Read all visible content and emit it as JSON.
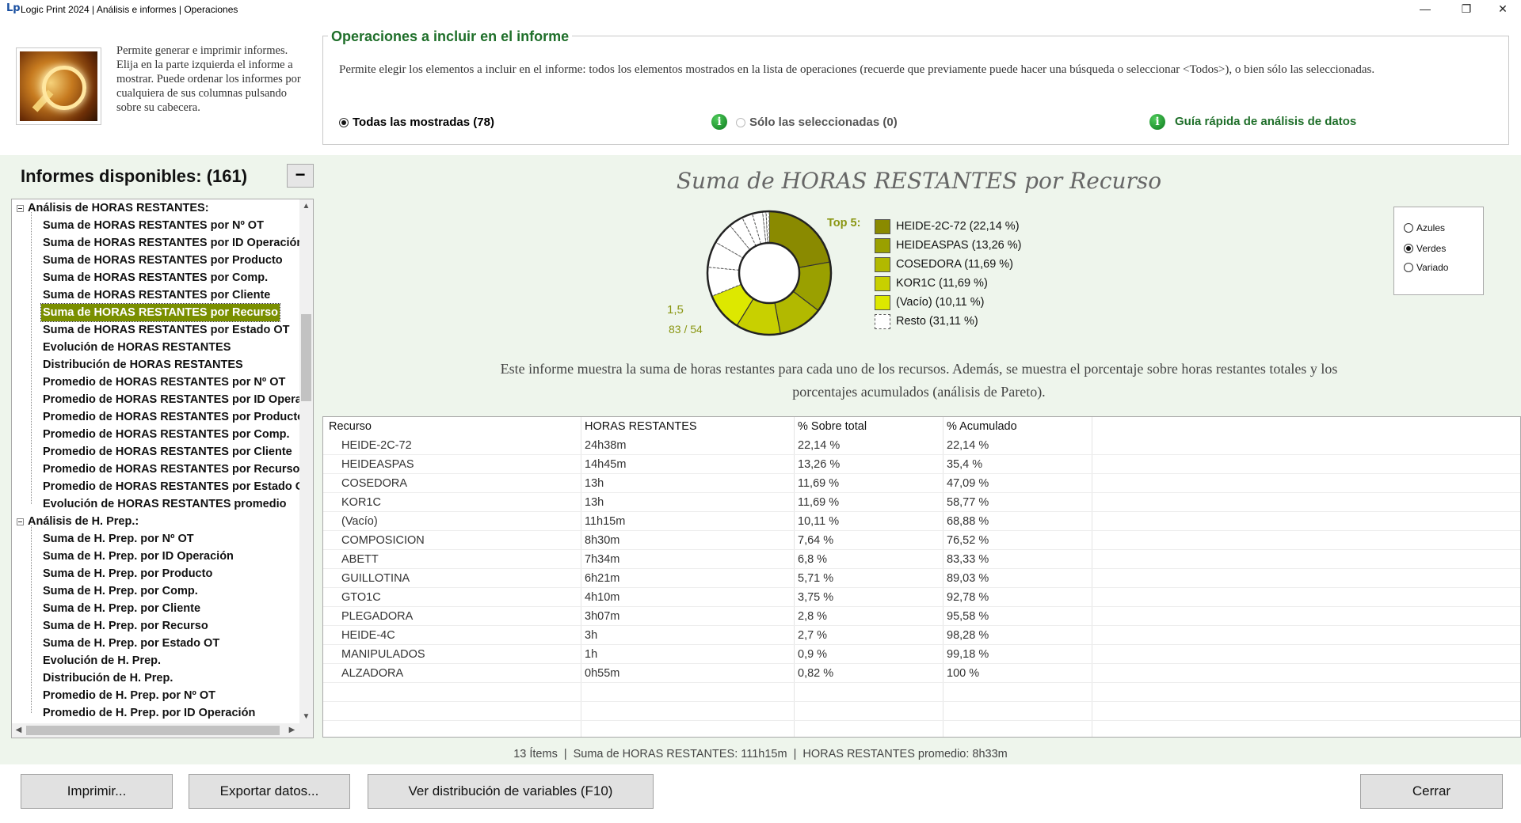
{
  "window": {
    "title": "Logic Print 2024 | Análisis e informes | Operaciones",
    "logo": "Lp",
    "minimize": "—",
    "restore": "❐",
    "close": "✕"
  },
  "intro": {
    "text": "Permite generar e imprimir informes. Elija en la parte izquierda el informe a mostrar. Puede ordenar los informes por cualquiera de sus columnas pulsando sobre su cabecera."
  },
  "operations": {
    "title": "Operaciones a incluir en el informe",
    "description": "Permite elegir los elementos a incluir en el informe: todos los elementos mostrados en la lista de operaciones (recuerde que previamente puede hacer una búsqueda o seleccionar <Todos>), o bien sólo las seleccionadas.",
    "option_all": "Todas las mostradas (78)",
    "option_selected": "Sólo las seleccionadas (0)",
    "guide_link": "Guía rápida de análisis de datos",
    "info_glyph": "i"
  },
  "reports": {
    "header": "Informes disponibles:  (161)",
    "collapse_label": "−",
    "groups": [
      {
        "label": "Análisis de HORAS RESTANTES:",
        "items": [
          "Suma de HORAS RESTANTES por Nº OT",
          "Suma de HORAS RESTANTES por ID Operación",
          "Suma de HORAS RESTANTES por Producto",
          "Suma de HORAS RESTANTES por Comp.",
          "Suma de HORAS RESTANTES por Cliente",
          "Suma de HORAS RESTANTES por Recurso",
          "Suma de HORAS RESTANTES por Estado OT",
          "Evolución de HORAS RESTANTES",
          "Distribución de HORAS RESTANTES",
          "Promedio de HORAS RESTANTES por Nº OT",
          "Promedio de HORAS RESTANTES por ID Opera",
          "Promedio de HORAS RESTANTES por Producto",
          "Promedio de HORAS RESTANTES por Comp.",
          "Promedio de HORAS RESTANTES por Cliente",
          "Promedio de HORAS RESTANTES por Recurso",
          "Promedio de HORAS RESTANTES por Estado O",
          "Evolución de HORAS RESTANTES promedio"
        ]
      },
      {
        "label": "Análisis de H. Prep.:",
        "items": [
          "Suma de H. Prep. por Nº OT",
          "Suma de H. Prep. por ID Operación",
          "Suma de H. Prep. por Producto",
          "Suma de H. Prep. por Comp.",
          "Suma de H. Prep. por Cliente",
          "Suma de H. Prep. por Recurso",
          "Suma de H. Prep. por Estado OT",
          "Evolución de H. Prep.",
          "Distribución de H. Prep.",
          "Promedio de H. Prep. por Nº OT",
          "Promedio de H. Prep. por ID Operación"
        ]
      }
    ],
    "selected": "Suma de HORAS RESTANTES por Recurso",
    "scroll_up": "▲",
    "scroll_down": "▼",
    "scroll_left": "◀",
    "scroll_right": "▶"
  },
  "chart": {
    "title": "Suma de HORAS RESTANTES por Recurso",
    "top5_label": "Top 5:",
    "scale_value": "1,5",
    "ratio_value": "83 / 54",
    "description": "Este informe muestra la suma de horas restantes para cada uno de los recursos. Además, se muestra el porcentaje sobre horas restantes totales y los porcentajes acumulados (análisis de Pareto).",
    "palette": {
      "options": [
        "Azules",
        "Verdes",
        "Variado"
      ],
      "selected": "Verdes"
    }
  },
  "chart_data": {
    "type": "pie",
    "title": "Suma de HORAS RESTANTES por Recurso",
    "slices": [
      {
        "label": "HEIDE-2C-72 (22,14 %)",
        "value": 22.14,
        "color": "#8a8a00"
      },
      {
        "label": "HEIDEASPAS (13,26 %)",
        "value": 13.26,
        "color": "#9aa000"
      },
      {
        "label": "COSEDORA (11,69 %)",
        "value": 11.69,
        "color": "#b2b900"
      },
      {
        "label": "KOR1C (11,69 %)",
        "value": 11.69,
        "color": "#c8d000"
      },
      {
        "label": "(Vacío) (10,11 %)",
        "value": 10.11,
        "color": "#dde800"
      },
      {
        "label": "Resto (31,11 %)",
        "value": 31.11,
        "color": "#ffffff",
        "rest": true
      }
    ],
    "rest_subdivisions": [
      7.64,
      6.8,
      5.71,
      3.75,
      2.8,
      2.7,
      0.9,
      0.82
    ]
  },
  "table": {
    "headers": [
      "Recurso",
      "HORAS RESTANTES",
      "% Sobre total",
      "% Acumulado"
    ],
    "rows": [
      [
        "HEIDE-2C-72",
        "24h38m",
        "22,14 %",
        "22,14 %"
      ],
      [
        "HEIDEASPAS",
        "14h45m",
        "13,26 %",
        "35,4 %"
      ],
      [
        "COSEDORA",
        "13h",
        "11,69 %",
        "47,09 %"
      ],
      [
        "KOR1C",
        "13h",
        "11,69 %",
        "58,77 %"
      ],
      [
        "(Vacío)",
        "11h15m",
        "10,11 %",
        "68,88 %"
      ],
      [
        "COMPOSICION",
        "8h30m",
        "7,64 %",
        "76,52 %"
      ],
      [
        "ABETT",
        "7h34m",
        "6,8 %",
        "83,33 %"
      ],
      [
        "GUILLOTINA",
        "6h21m",
        "5,71 %",
        "89,03 %"
      ],
      [
        "GTO1C",
        "4h10m",
        "3,75 %",
        "92,78 %"
      ],
      [
        "PLEGADORA",
        "3h07m",
        "2,8 %",
        "95,58 %"
      ],
      [
        "HEIDE-4C",
        "3h",
        "2,7 %",
        "98,28 %"
      ],
      [
        "MANIPULADOS",
        "1h",
        "0,9 %",
        "99,18 %"
      ],
      [
        "ALZADORA",
        "0h55m",
        "0,82 %",
        "100 %"
      ]
    ]
  },
  "status": {
    "items": "13 Ítems",
    "sum": "Suma de HORAS RESTANTES: 111h15m",
    "avg": "HORAS RESTANTES promedio: 8h33m",
    "separator": "|"
  },
  "buttons": {
    "print": "Imprimir...",
    "export": "Exportar datos...",
    "distribution": "Ver distribución de variables  (F10)",
    "close": "Cerrar"
  }
}
